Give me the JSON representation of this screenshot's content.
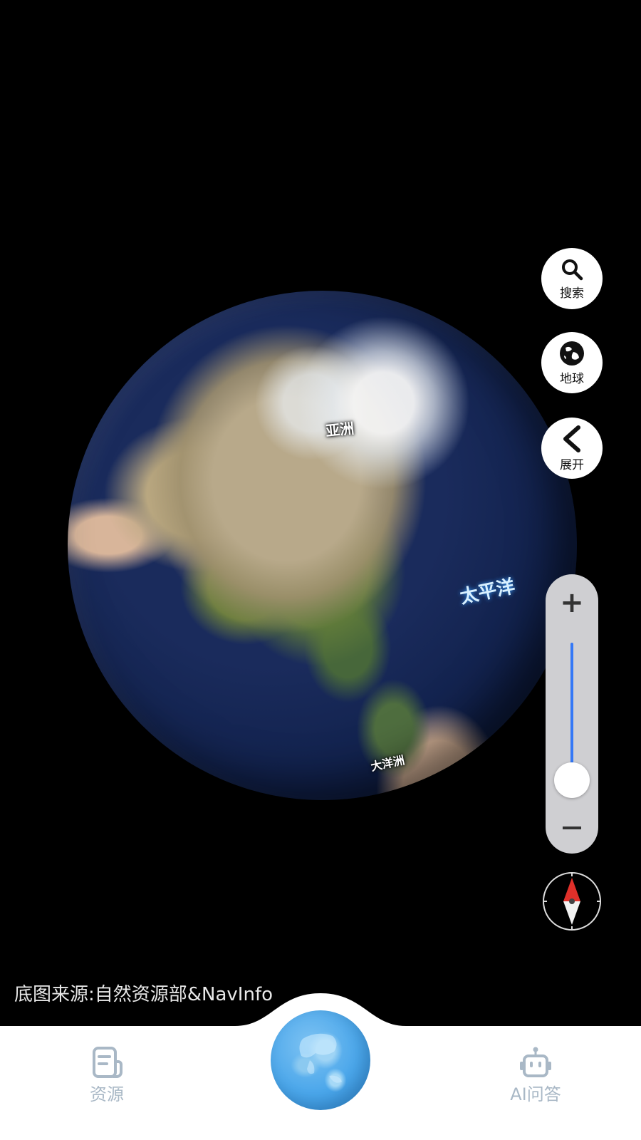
{
  "map": {
    "labels": {
      "asia": "亚洲",
      "pacific": "太平洋",
      "oceania": "大洋洲"
    },
    "attribution": "底图来源:自然资源部&NavInfo"
  },
  "controls": {
    "search": {
      "icon": "search-icon",
      "label": "搜索"
    },
    "earth": {
      "icon": "globe-icon",
      "label": "地球"
    },
    "expand": {
      "icon": "chevron-left-icon",
      "label": "展开"
    },
    "zoom": {
      "plus": "+",
      "level": 0.1
    },
    "compass": {
      "icon": "compass-icon"
    }
  },
  "bottom_nav": {
    "resources": {
      "icon": "document-icon",
      "label": "资源"
    },
    "center": {
      "icon": "globe-icon"
    },
    "ai": {
      "icon": "robot-icon",
      "label": "AI问答"
    }
  },
  "colors": {
    "accent": "#3478f6",
    "nav_inactive": "#a9b8c6"
  }
}
